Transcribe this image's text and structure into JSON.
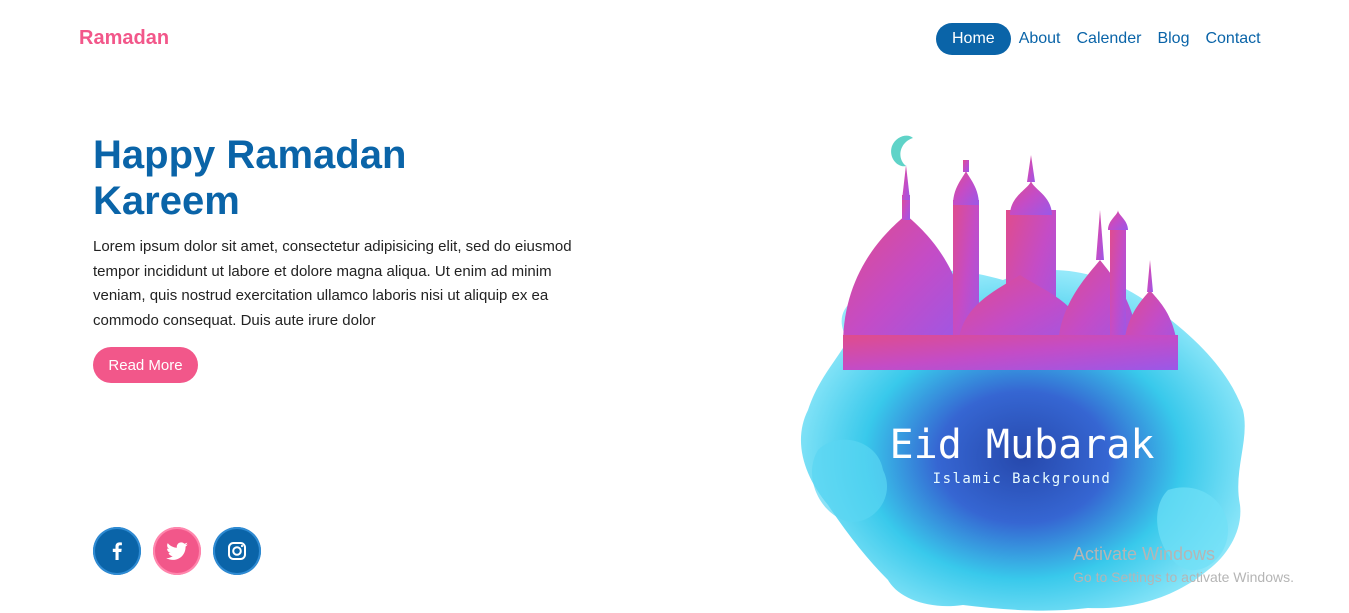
{
  "brand": "Ramadan",
  "nav": {
    "items": [
      {
        "label": "Home",
        "active": true
      },
      {
        "label": "About"
      },
      {
        "label": "Calender"
      },
      {
        "label": "Blog"
      },
      {
        "label": "Contact"
      }
    ]
  },
  "hero": {
    "title": "Happy Ramadan Kareem",
    "text": "Lorem ipsum dolor sit amet, consectetur adipisicing elit, sed do eiusmod tempor incididunt ut labore et dolore magna aliqua. Ut enim ad minim veniam, quis nostrud exercitation ullamco laboris nisi ut aliquip ex ea commodo consequat. Duis aute irure dolor",
    "button_label": "Read More"
  },
  "social": [
    {
      "icon": "facebook-icon",
      "color": "#0a64a8"
    },
    {
      "icon": "twitter-icon",
      "color": "#f2578a"
    },
    {
      "icon": "instagram-icon",
      "color": "#0a64a8"
    }
  ],
  "illustration": {
    "title": "Eid Mubarak",
    "subtitle": "Islamic Background"
  },
  "watermark": {
    "title": "Activate Windows",
    "subtitle": "Go to Settings to activate Windows."
  },
  "colors": {
    "brand": "#f2578a",
    "primary": "#0a64a8",
    "text": "#222222"
  }
}
